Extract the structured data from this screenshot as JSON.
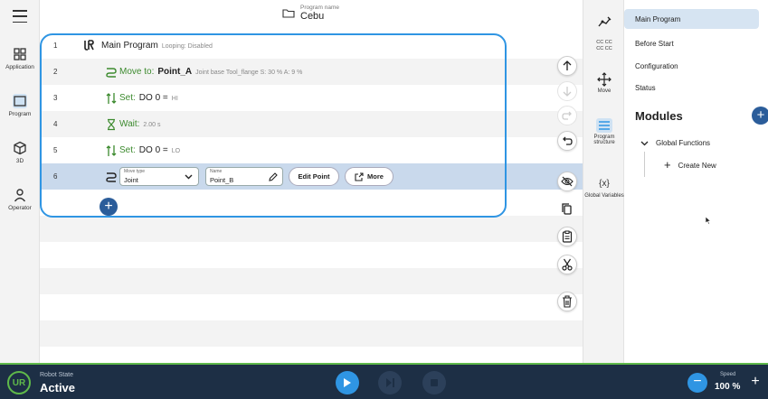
{
  "leftnav": {
    "items": [
      {
        "label": "Application",
        "icon": "grid-icon"
      },
      {
        "label": "Program",
        "icon": "program-icon"
      },
      {
        "label": "3D",
        "icon": "cube-icon"
      },
      {
        "label": "Operator",
        "icon": "person-icon"
      }
    ]
  },
  "header": {
    "program_name_label": "Program name",
    "program_name": "Cebu"
  },
  "program": {
    "rows": [
      {
        "num": "1",
        "title": "Main Program",
        "meta": "Looping: Disabled"
      },
      {
        "num": "2",
        "title": "Move to:",
        "target": "Point_A",
        "meta": "Joint  base  Tool_flange  S: 30 %  A: 9 %"
      },
      {
        "num": "3",
        "title": "Set:",
        "target": "DO 0 =",
        "meta": "HI"
      },
      {
        "num": "4",
        "title": "Wait:",
        "meta": "2.00 s"
      },
      {
        "num": "5",
        "title": "Set:",
        "target": "DO 0 =",
        "meta": "LO"
      },
      {
        "num": "6"
      }
    ],
    "editor": {
      "move_type_label": "Move type",
      "move_type_value": "Joint",
      "name_label": "Name",
      "name_value": "Point_B",
      "edit_point_label": "Edit Point",
      "more_label": "More"
    }
  },
  "toolstrip": {
    "items": [
      {
        "label": "",
        "icon": "robot-arm-icon"
      },
      {
        "label": "CC CC\nCC CC",
        "icon": "io-icon"
      },
      {
        "label": "Move",
        "icon": "move-icon"
      },
      {
        "label": "Program structure",
        "icon": "list-icon"
      },
      {
        "label": "Global Variables",
        "icon": "variables-icon"
      }
    ]
  },
  "rightpanel": {
    "items": [
      "Main Program",
      "Before Start",
      "Configuration",
      "Status"
    ],
    "modules_title": "Modules",
    "global_functions": "Global Functions",
    "create_new": "Create New"
  },
  "footer": {
    "robot_state_label": "Robot State",
    "robot_state": "Active",
    "speed_label": "Speed",
    "speed_value": "100 %"
  },
  "colors": {
    "accent": "#2f95e3",
    "footer_bg": "#1d2f45",
    "active_green": "#5fb94a",
    "command_green": "#3c8a2e"
  }
}
